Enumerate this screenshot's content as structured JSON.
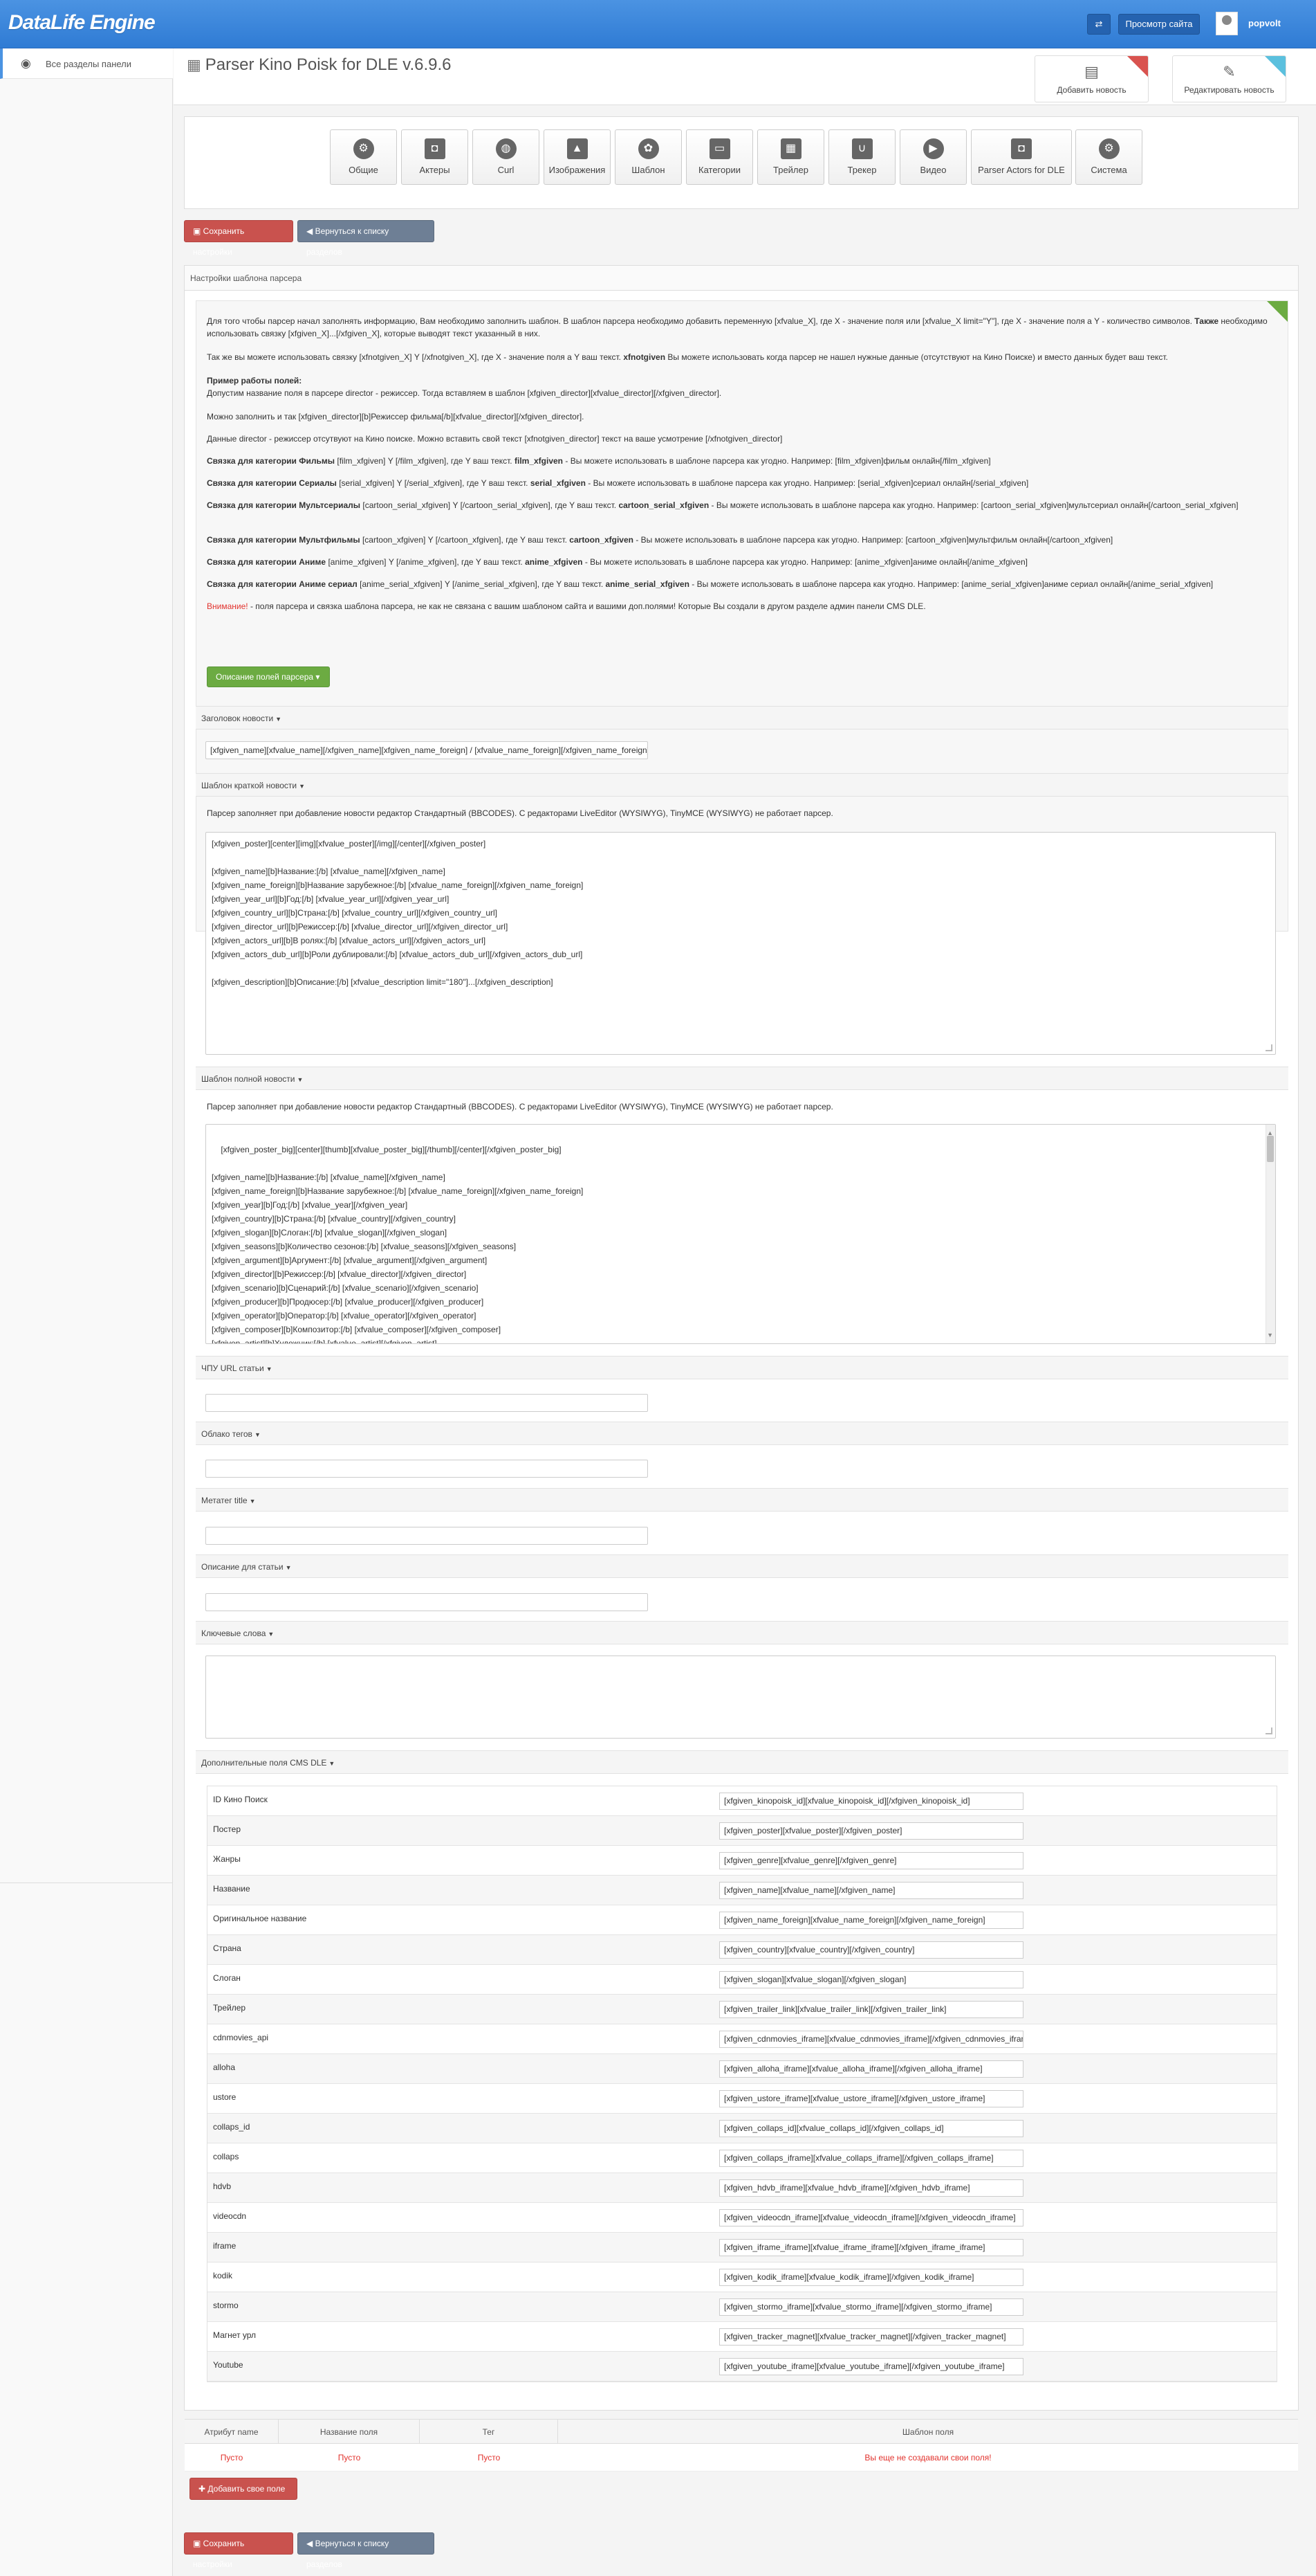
{
  "topbar": {
    "logo": "DataLife Engine",
    "switch_icon": "swap-icon",
    "view_site_label": "Просмотр сайта",
    "username": "popvolt"
  },
  "sidebar": {
    "items": [
      {
        "label": "Все разделы панели",
        "icon": "globe-icon"
      }
    ]
  },
  "header": {
    "title": "Parser Kino Poisk for DLE v.6.9.6",
    "actions": [
      {
        "label": "Добавить новость",
        "icon": "document-icon"
      },
      {
        "label": "Редактировать новость",
        "icon": "edit-icon"
      }
    ]
  },
  "nav": {
    "tabs": [
      {
        "label": "Общие",
        "icon": "gear-icon"
      },
      {
        "label": "Актеры",
        "icon": "camera-icon"
      },
      {
        "label": "Curl",
        "icon": "globe-icon"
      },
      {
        "label": "Изображения",
        "icon": "image-icon"
      },
      {
        "label": "Шаблон",
        "icon": "palette-icon"
      },
      {
        "label": "Категории",
        "icon": "folder-icon"
      },
      {
        "label": "Трейлер",
        "icon": "film-icon"
      },
      {
        "label": "Трекер",
        "icon": "magnet-icon"
      },
      {
        "label": "Видео",
        "icon": "play-icon"
      },
      {
        "label": "Parser Actors for DLE",
        "icon": "camera-icon"
      },
      {
        "label": "Система",
        "icon": "gears-icon"
      }
    ]
  },
  "buttons": {
    "save": "Сохранить настройки",
    "back": "Вернуться к списку разделов",
    "fields_desc": "Описание полей парсера",
    "add_field": "Добавить свое поле"
  },
  "panel": {
    "title": "Настройки шаблона парсера"
  },
  "info": {
    "p1": "Для того чтобы парсер начал заполнять информацию, Вам необходимо заполнить шаблон. В шаблон парсера необходимо добавить переменную [xfvalue_X], где X - значение поля или [xfvalue_X limit=\"Y\"], где X - значение поля а Y - количество символов.",
    "p1_bold": "Также",
    "p1b": "необходимо использовать связку [xfgiven_X]...[/xfgiven_X], которые выводят текст указанный в них.",
    "p2a": "Так же вы можете использовать связку [xfnotgiven_X] Y [/xfnotgiven_X], где X - значение поля а Y ваш текст.",
    "p2_bold": "xfnotgiven",
    "p2b": "Вы можете использовать когда парсер не нашел нужные данные (отсутствуют на Кино Поиске) и вместо данных будет ваш текст.",
    "p3_title": "Пример работы полей:",
    "p3": "Допустим название поля в парсере director - режиссер. Тогда вставляем в шаблон [xfgiven_director][xfvalue_director][/xfgiven_director].",
    "p4": "Можно заполнить и так [xfgiven_director][b]Режиссер фильма[/b][xfvalue_director][/xfgiven_director].",
    "p5": "Данные director - режиссер отсутвуют на Кино поиске. Можно вставить свой текст [xfnotgiven_director] текст на ваше усмотрение [/xfnotgiven_director]",
    "p6_bold": "Связка для категории Фильмы",
    "p6": "[film_xfgiven] Y [/film_xfgiven], где Y ваш текст.",
    "p6_bold2": "film_xfgiven",
    "p6b": "- Вы можете использовать в шаблоне парсера как угодно. Например: [film_xfgiven]фильм онлайн[/film_xfgiven]",
    "p7_bold": "Связка для категории Сериалы",
    "p7": "[serial_xfgiven] Y [/serial_xfgiven], где Y ваш текст.",
    "p7_bold2": "serial_xfgiven",
    "p7b": "- Вы можете использовать в шаблоне парсера как угодно. Например: [serial_xfgiven]сериал онлайн[/serial_xfgiven]",
    "p8_bold": "Связка для категории Мультсериалы",
    "p8": "[cartoon_serial_xfgiven] Y [/cartoon_serial_xfgiven], где Y ваш текст.",
    "p8_bold2": "cartoon_serial_xfgiven",
    "p8b": "- Вы можете использовать в шаблоне парсера как угодно. Например: [cartoon_serial_xfgiven]мультсериал",
    "p8c": "онлайн[/cartoon_serial_xfgiven]",
    "p9_bold": "Связка для категории Мультфильмы",
    "p9": "[cartoon_xfgiven] Y [/cartoon_xfgiven], где Y ваш текст.",
    "p9_bold2": "cartoon_xfgiven",
    "p9b": "- Вы можете использовать в шаблоне парсера как угодно. Например: [cartoon_xfgiven]мультфильм онлайн[/cartoon_xfgiven]",
    "p10_bold": "Связка для категории Аниме",
    "p10": "[anime_xfgiven] Y [/anime_xfgiven], где Y ваш текст.",
    "p10_bold2": "anime_xfgiven",
    "p10b": "- Вы можете использовать в шаблоне парсера как угодно. Например: [anime_xfgiven]аниме онлайн[/anime_xfgiven]",
    "p11_bold": "Связка для категории Аниме сериал",
    "p11": "[anime_serial_xfgiven] Y [/anime_serial_xfgiven], где Y ваш текст.",
    "p11_bold2": "anime_serial_xfgiven",
    "p11b": "- Вы можете использовать в шаблоне парсера как угодно. Например: [anime_serial_xfgiven]аниме сериал онлайн[/anime_serial_xfgiven]",
    "warn_label": "Внимание!",
    "warn": "- поля парсера и связка шаблона парсера, не как не связана с вашим шаблоном сайта и вашими доп.полями! Которые Вы создали в другом разделе админ панели CMS DLE."
  },
  "sections": {
    "title_head": "Заголовок новости",
    "title_value": "[xfgiven_name][xfvalue_name][/xfgiven_name][xfgiven_name_foreign] / [xfvalue_name_foreign][/xfgiven_name_foreign]",
    "short_head": "Шаблон краткой новости",
    "short_note": "Парсер заполняет при добавление новости редактор Стандартный (BBCODES). С редакторами LiveEditor (WYSIWYG), TinyMCE (WYSIWYG) не работает парсер.",
    "short_value": "[xfgiven_poster][center][img][xfvalue_poster][/img][/center][/xfgiven_poster]\n\n[xfgiven_name][b]Название:[/b] [xfvalue_name][/xfgiven_name]\n[xfgiven_name_foreign][b]Название зарубежное:[/b] [xfvalue_name_foreign][/xfgiven_name_foreign]\n[xfgiven_year_url][b]Год:[/b] [xfvalue_year_url][/xfgiven_year_url]\n[xfgiven_country_url][b]Страна:[/b] [xfvalue_country_url][/xfgiven_country_url]\n[xfgiven_director_url][b]Режиссер:[/b] [xfvalue_director_url][/xfgiven_director_url]\n[xfgiven_actors_url][b]В ролях:[/b] [xfvalue_actors_url][/xfgiven_actors_url]\n[xfgiven_actors_dub_url][b]Роли дублировали:[/b] [xfvalue_actors_dub_url][/xfgiven_actors_dub_url]\n\n[xfgiven_description][b]Описание:[/b] [xfvalue_description limit=\"180\"]...[/xfgiven_description]",
    "full_head": "Шаблон полной новости",
    "full_note": "Парсер заполняет при добавление новости редактор Стандартный (BBCODES). С редакторами LiveEditor (WYSIWYG), TinyMCE (WYSIWYG) не работает парсер.",
    "full_value": "[xfgiven_poster_big][center][thumb][xfvalue_poster_big][/thumb][/center][/xfgiven_poster_big]\n\n[xfgiven_name][b]Название:[/b] [xfvalue_name][/xfgiven_name]\n[xfgiven_name_foreign][b]Название зарубежное:[/b] [xfvalue_name_foreign][/xfgiven_name_foreign]\n[xfgiven_year][b]Год:[/b] [xfvalue_year][/xfgiven_year]\n[xfgiven_country][b]Страна:[/b] [xfvalue_country][/xfgiven_country]\n[xfgiven_slogan][b]Слоган:[/b] [xfvalue_slogan][/xfgiven_slogan]\n[xfgiven_seasons][b]Количество сезонов:[/b] [xfvalue_seasons][/xfgiven_seasons]\n[xfgiven_argument][b]Аргумент:[/b] [xfvalue_argument][/xfgiven_argument]\n[xfgiven_director][b]Режиссер:[/b] [xfvalue_director][/xfgiven_director]\n[xfgiven_scenario][b]Сценарий:[/b] [xfvalue_scenario][/xfgiven_scenario]\n[xfgiven_producer][b]Продюсер:[/b] [xfvalue_producer][/xfgiven_producer]\n[xfgiven_operator][b]Оператор:[/b] [xfvalue_operator][/xfgiven_operator]\n[xfgiven_composer][b]Композитор:[/b] [xfvalue_composer][/xfgiven_composer]\n[xfgiven_artist][b]Художник:[/b] [xfvalue_artist][/xfgiven_artist]\n[xfgiven_installation][b]Монтаж:[/b] [xfvalue_installation][/xfgiven_installation]",
    "url_head": "ЧПУ URL статьи",
    "tags_head": "Облако тегов",
    "meta_head": "Метатег title",
    "desc_head": "Описание для статьи",
    "keywords_head": "Ключевые слова",
    "xfields_head": "Дополнительные поля CMS DLE"
  },
  "xfields": [
    {
      "label": "ID Кино Поиск",
      "value": "[xfgiven_kinopoisk_id][xfvalue_kinopoisk_id][/xfgiven_kinopoisk_id]"
    },
    {
      "label": "Постер",
      "value": "[xfgiven_poster][xfvalue_poster][/xfgiven_poster]"
    },
    {
      "label": "Жанры",
      "value": "[xfgiven_genre][xfvalue_genre][/xfgiven_genre]"
    },
    {
      "label": "Название",
      "value": "[xfgiven_name][xfvalue_name][/xfgiven_name]"
    },
    {
      "label": "Оригинальное название",
      "value": "[xfgiven_name_foreign][xfvalue_name_foreign][/xfgiven_name_foreign]"
    },
    {
      "label": "Страна",
      "value": "[xfgiven_country][xfvalue_country][/xfgiven_country]"
    },
    {
      "label": "Слоган",
      "value": "[xfgiven_slogan][xfvalue_slogan][/xfgiven_slogan]"
    },
    {
      "label": "Трейлер",
      "value": "[xfgiven_trailer_link][xfvalue_trailer_link][/xfgiven_trailer_link]"
    },
    {
      "label": "cdnmovies_api",
      "value": "[xfgiven_cdnmovies_iframe][xfvalue_cdnmovies_iframe][/xfgiven_cdnmovies_iframe]"
    },
    {
      "label": "alloha",
      "value": "[xfgiven_alloha_iframe][xfvalue_alloha_iframe][/xfgiven_alloha_iframe]"
    },
    {
      "label": "ustore",
      "value": "[xfgiven_ustore_iframe][xfvalue_ustore_iframe][/xfgiven_ustore_iframe]"
    },
    {
      "label": "collaps_id",
      "value": "[xfgiven_collaps_id][xfvalue_collaps_id][/xfgiven_collaps_id]"
    },
    {
      "label": "collaps",
      "value": "[xfgiven_collaps_iframe][xfvalue_collaps_iframe][/xfgiven_collaps_iframe]"
    },
    {
      "label": "hdvb",
      "value": "[xfgiven_hdvb_iframe][xfvalue_hdvb_iframe][/xfgiven_hdvb_iframe]"
    },
    {
      "label": "videocdn",
      "value": "[xfgiven_videocdn_iframe][xfvalue_videocdn_iframe][/xfgiven_videocdn_iframe]"
    },
    {
      "label": "iframe",
      "value": "[xfgiven_iframe_iframe][xfvalue_iframe_iframe][/xfgiven_iframe_iframe]"
    },
    {
      "label": "kodik",
      "value": "[xfgiven_kodik_iframe][xfvalue_kodik_iframe][/xfgiven_kodik_iframe]"
    },
    {
      "label": "stormo",
      "value": "[xfgiven_stormo_iframe][xfvalue_stormo_iframe][/xfgiven_stormo_iframe]"
    },
    {
      "label": "Магнет урл",
      "value": "[xfgiven_tracker_magnet][xfvalue_tracker_magnet][/xfgiven_tracker_magnet]"
    },
    {
      "label": "Youtube",
      "value": "[xfgiven_youtube_iframe][xfvalue_youtube_iframe][/xfgiven_youtube_iframe]"
    }
  ],
  "custom_table": {
    "headers": [
      "Атрибут name",
      "Название поля",
      "Тег",
      "Шаблон поля"
    ],
    "empty": "Пусто",
    "none_created": "Вы еще не создавали свои поля!"
  },
  "colors": {
    "topbar": "#3a86dc",
    "save_button": "#c9524e",
    "back_button": "#6e7f95",
    "desc_button": "#6cab42",
    "empty_text": "#e2332e"
  }
}
